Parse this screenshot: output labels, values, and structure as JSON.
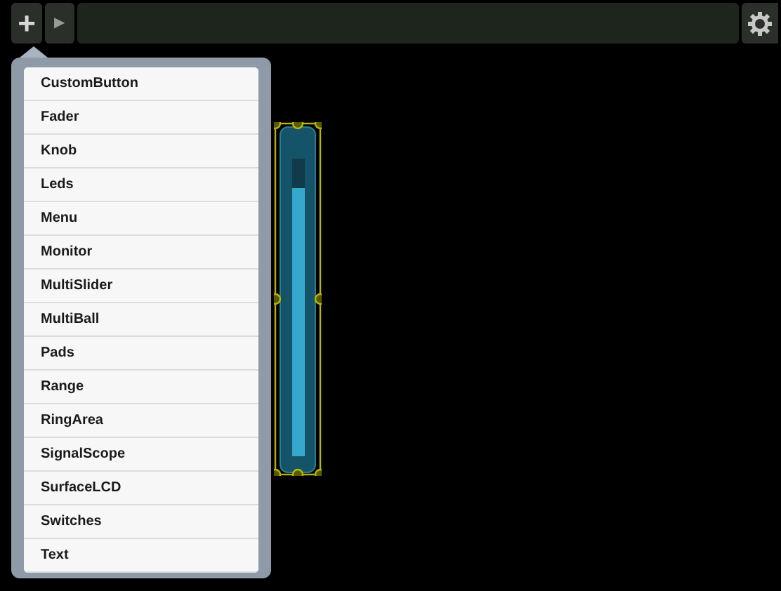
{
  "toolbar": {
    "add_button": "+",
    "play_button": "▶"
  },
  "add_menu": {
    "open": true,
    "items": [
      {
        "label": "CustomButton"
      },
      {
        "label": "Fader"
      },
      {
        "label": "Knob"
      },
      {
        "label": "Leds"
      },
      {
        "label": "Menu"
      },
      {
        "label": "Monitor"
      },
      {
        "label": "MultiSlider"
      },
      {
        "label": "MultiBall"
      },
      {
        "label": "Pads"
      },
      {
        "label": "Range"
      },
      {
        "label": "RingArea"
      },
      {
        "label": "SignalScope"
      },
      {
        "label": "SurfaceLCD"
      },
      {
        "label": "Switches"
      },
      {
        "label": "Text"
      }
    ]
  },
  "canvas": {
    "fader": {
      "level": 0.9,
      "selected": true
    }
  }
}
